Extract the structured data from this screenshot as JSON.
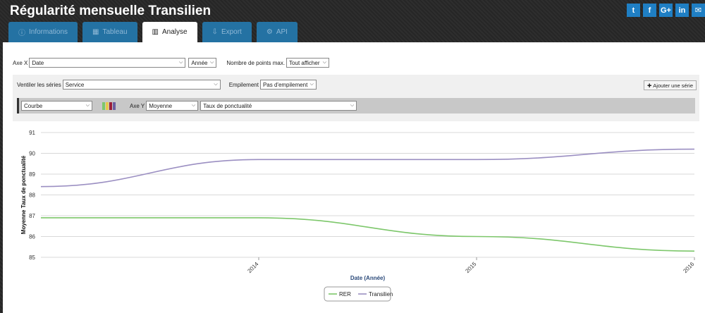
{
  "header": {
    "title": "Régularité mensuelle Transilien"
  },
  "social": [
    {
      "icon": "twitter-icon",
      "glyph": "t"
    },
    {
      "icon": "facebook-icon",
      "glyph": "f"
    },
    {
      "icon": "google-plus-icon",
      "glyph": "G+"
    },
    {
      "icon": "linkedin-icon",
      "glyph": "in"
    },
    {
      "icon": "email-icon",
      "glyph": "✉"
    }
  ],
  "tabs": [
    {
      "label": "Informations",
      "icon": "info-icon",
      "glyph": "ⓘ"
    },
    {
      "label": "Tableau",
      "icon": "table-icon",
      "glyph": "▦"
    },
    {
      "label": "Analyse",
      "icon": "bar-chart-icon",
      "glyph": "▥",
      "active": true
    },
    {
      "label": "Export",
      "icon": "download-icon",
      "glyph": "⇩"
    },
    {
      "label": "API",
      "icon": "cogs-icon",
      "glyph": "⚙"
    }
  ],
  "controls": {
    "axe_x_label": "Axe X",
    "axe_x_value": "Date",
    "axe_x_unit": "Année",
    "max_points_label": "Nombre de points max.",
    "max_points_value": "Tout afficher",
    "ventiler_label": "Ventiler les séries",
    "ventiler_value": "Service",
    "empilement_label": "Empilement",
    "empilement_value": "Pas d'empilement",
    "add_series_label": "Ajouter une série",
    "series_type": "Courbe",
    "axe_y_label": "Axe Y",
    "axe_y_agg": "Moyenne",
    "axe_y_field": "Taux de ponctualité"
  },
  "colors": {
    "rer": "#7dc76b",
    "transilien": "#9b8fc2",
    "accent": "#2472a3",
    "swatch": [
      "#7dc76b",
      "#e8c84a",
      "#9b1f3a",
      "#6b5fa0"
    ]
  },
  "chart_data": {
    "type": "line",
    "x": [
      2013,
      2014,
      2015,
      2016
    ],
    "xlim": [
      2013,
      2016
    ],
    "xticks": [
      "2014",
      "2015",
      "2016"
    ],
    "ylim": [
      85,
      91
    ],
    "yticks": [
      "85",
      "86",
      "87",
      "88",
      "89",
      "90",
      "91"
    ],
    "xlabel": "Date (Année)",
    "ylabel": "Moyenne Taux de ponctualité",
    "grid": true,
    "legend": "bottom-center",
    "series": [
      {
        "name": "RER",
        "values": [
          86.9,
          86.9,
          86.0,
          85.3
        ]
      },
      {
        "name": "Transilien",
        "values": [
          88.4,
          89.7,
          89.7,
          90.2
        ]
      }
    ]
  }
}
